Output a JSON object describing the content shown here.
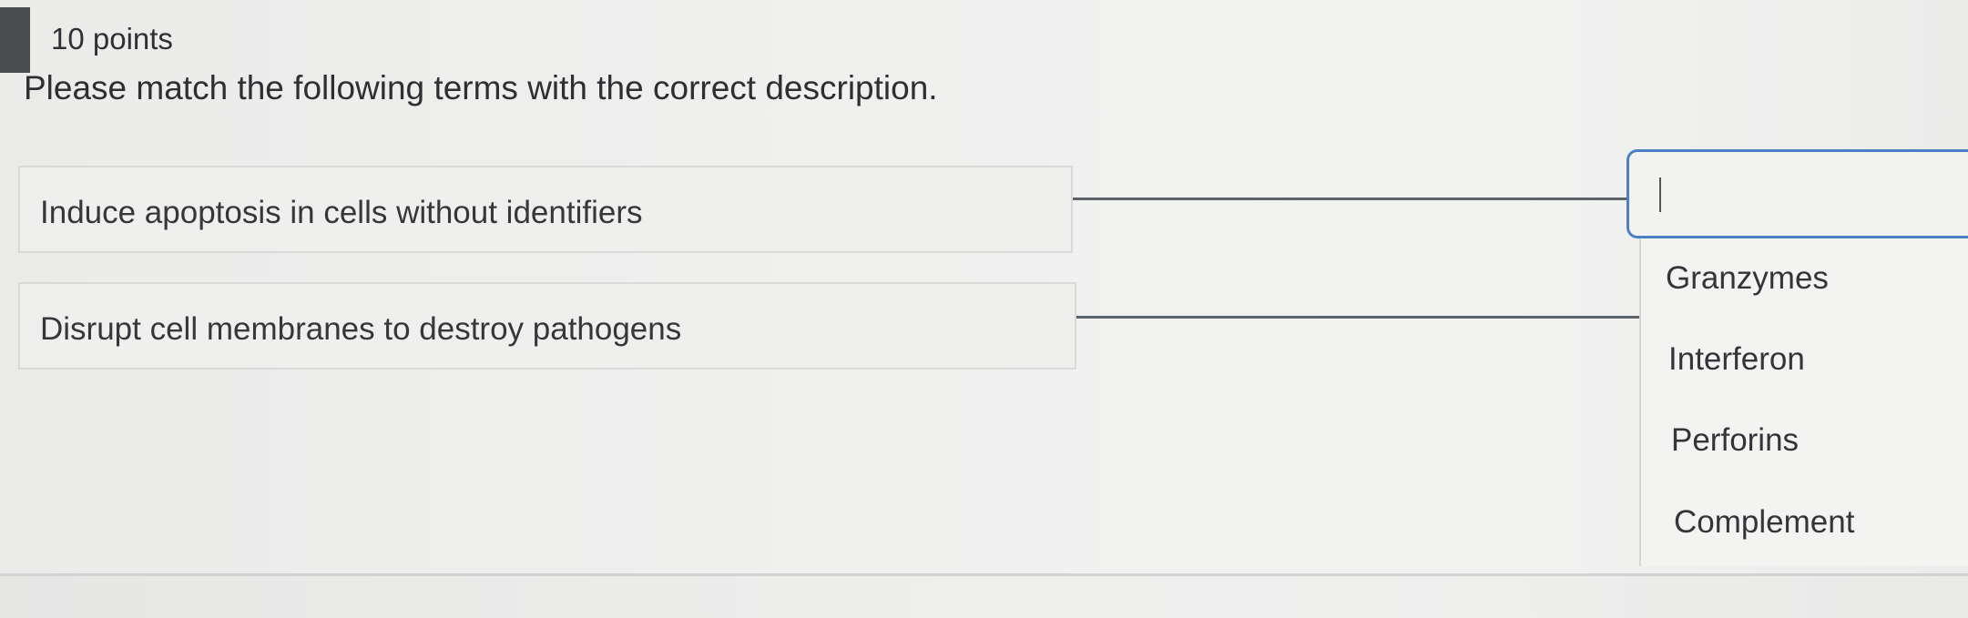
{
  "question": {
    "points": "10 points",
    "text": "Please match the following terms with the correct description."
  },
  "prompts": [
    {
      "text": "Induce apoptosis in cells without identifiers",
      "selected_answer": ""
    },
    {
      "text": "Disrupt cell membranes to destroy pathogens",
      "selected_answer": ""
    }
  ],
  "dropdown": {
    "open": true,
    "options": [
      "Granzymes",
      "Interferon",
      "Perforins",
      "Complement"
    ]
  },
  "colors": {
    "focus_border": "#4d80c2",
    "connector_line": "#5d6168",
    "points_flag": "#4a4c50"
  }
}
